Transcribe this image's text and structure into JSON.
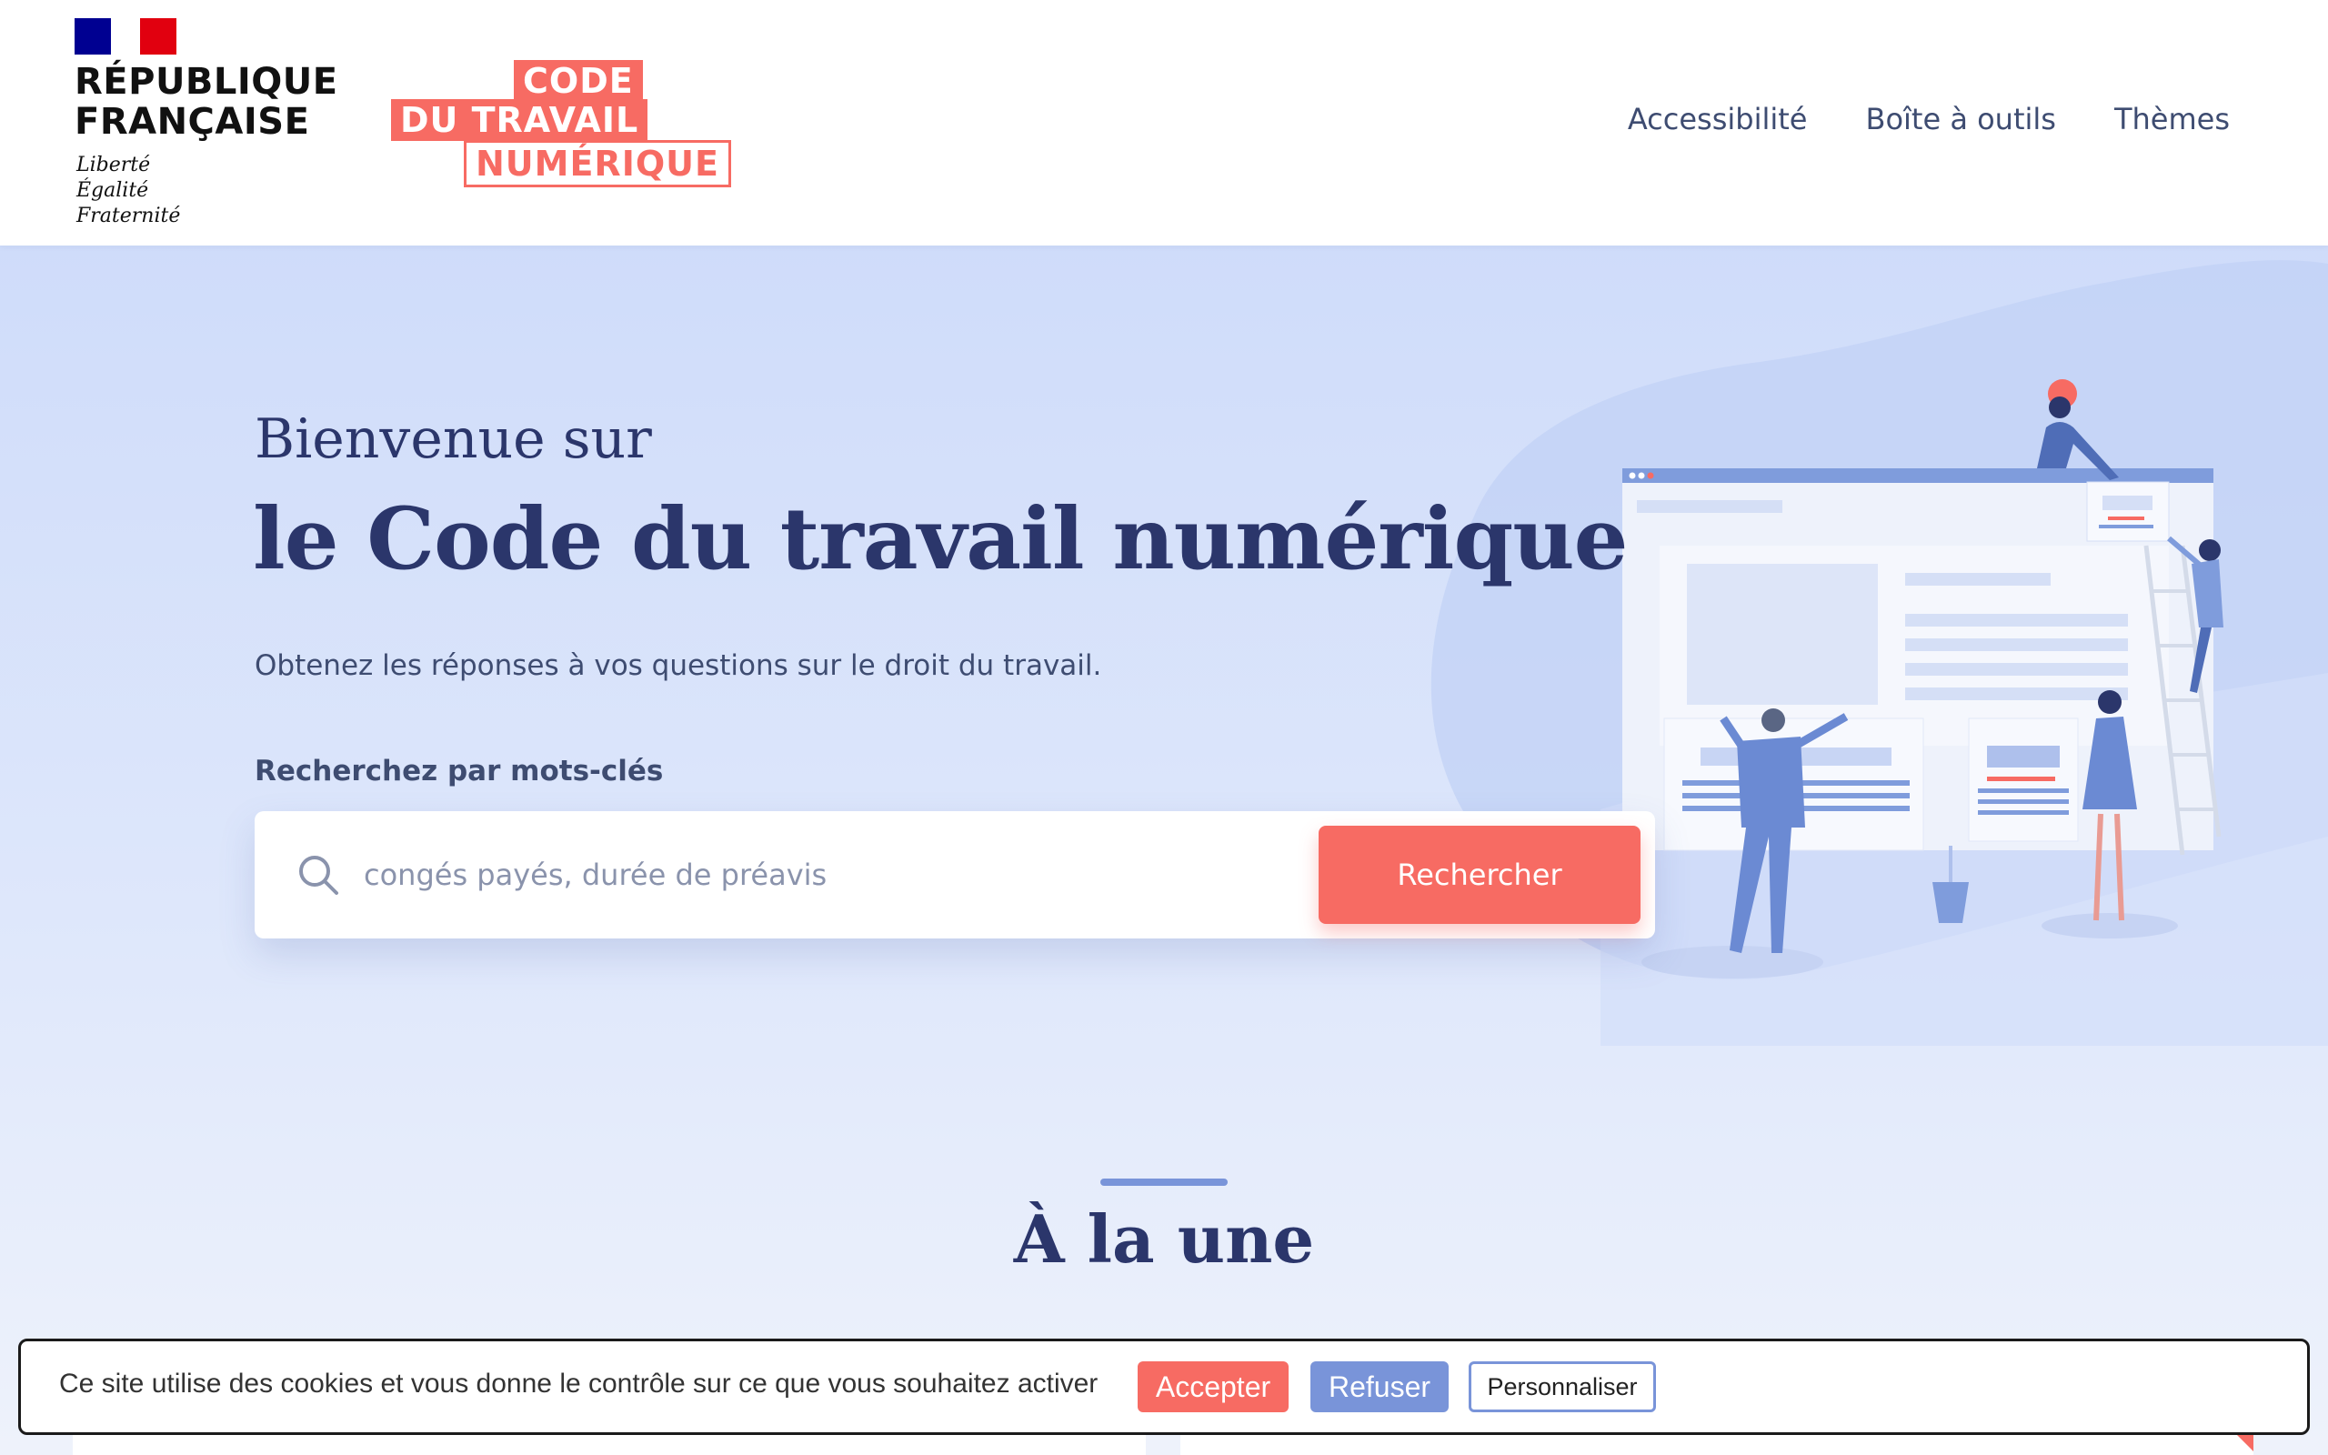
{
  "header": {
    "rf": {
      "name_line1": "RÉPUBLIQUE",
      "name_line2": "FRANÇAISE",
      "motto_line1": "Liberté",
      "motto_line2": "Égalité",
      "motto_line3": "Fraternité"
    },
    "logo": {
      "line1": "CODE",
      "line2": "DU TRAVAIL",
      "line3": "NUMÉRIQUE"
    },
    "nav": [
      {
        "label": "Accessibilité"
      },
      {
        "label": "Boîte à outils"
      },
      {
        "label": "Thèmes"
      }
    ]
  },
  "hero": {
    "welcome": "Bienvenue sur",
    "title": "le Code du travail numérique",
    "subtitle": "Obtenez les réponses à vos questions sur le droit du travail.",
    "search_label": "Recherchez par mots-clés",
    "search_placeholder": "congés payés, durée de préavis",
    "search_button": "Rechercher"
  },
  "une": {
    "title": "À la une"
  },
  "cookie_banner": {
    "text": "Ce site utilise des cookies et vous donne le contrôle sur ce que vous souhaitez activer",
    "accept": "Accepter",
    "refuse": "Refuser",
    "customize": "Personnaliser"
  },
  "colors": {
    "primary": "#2b366b",
    "accent": "#f76b63",
    "secondary": "#7994d9",
    "hero_bg": "#cfdcfa"
  }
}
